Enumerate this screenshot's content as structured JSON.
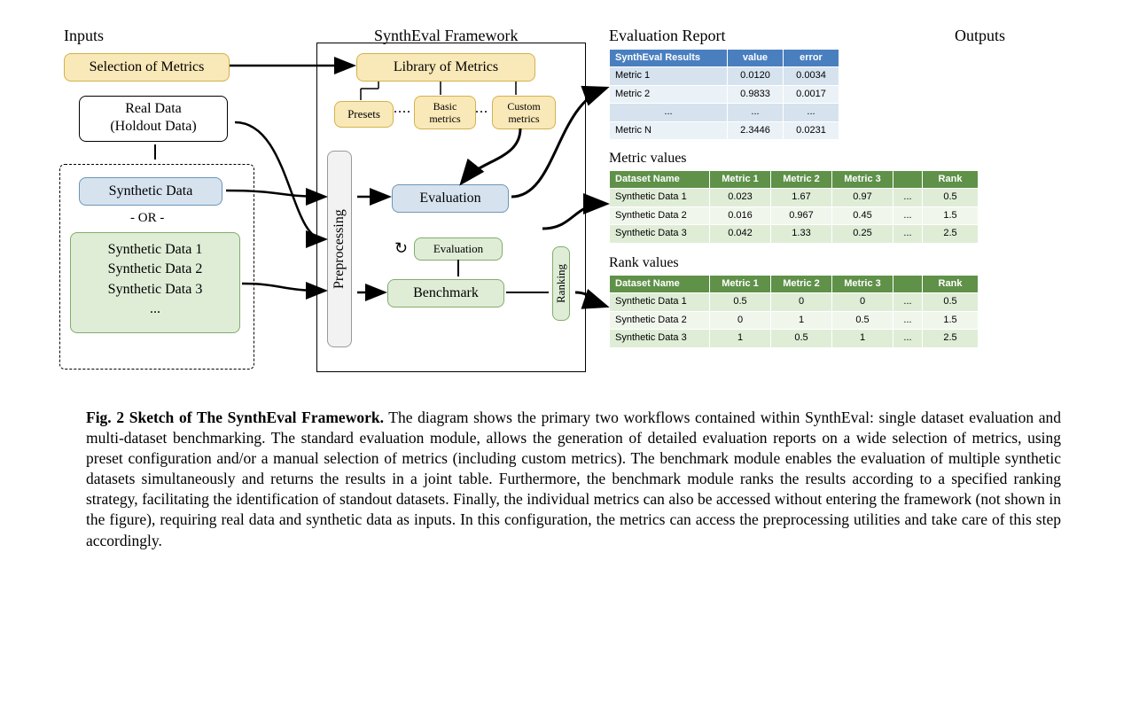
{
  "headings": {
    "inputs": "Inputs",
    "framework": "SynthEval Framework",
    "report": "Evaluation Report",
    "outputs": "Outputs",
    "metric_values": "Metric values",
    "rank_values": "Rank values"
  },
  "inputs": {
    "selection": "Selection of Metrics",
    "real": "Real Data\n(Holdout Data)",
    "synth_single": "Synthetic Data",
    "or": "- OR -",
    "synth_multi": "Synthetic Data 1\nSynthetic Data 2\nSynthetic Data 3\n...",
    "synth1": "Synthetic Data 1",
    "synth2": "Synthetic Data 2",
    "synth3": "Synthetic Data 3",
    "dots": "..."
  },
  "framework": {
    "library": "Library of Metrics",
    "presets": "Presets",
    "basic": "Basic\nmetrics",
    "custom": "Custom\nmetrics",
    "preprocessing": "Preprocessing",
    "evaluation": "Evaluation",
    "evaluation_small": "Evaluation",
    "benchmark": "Benchmark",
    "ranking": "Ranking",
    "refresh": "↻"
  },
  "report_table": {
    "headers": [
      "SynthEval Results",
      "value",
      "error"
    ],
    "rows": [
      [
        "Metric 1",
        "0.0120",
        "0.0034"
      ],
      [
        "Metric 2",
        "0.9833",
        "0.0017"
      ],
      [
        "...",
        "...",
        "..."
      ],
      [
        "Metric N",
        "2.3446",
        "0.0231"
      ]
    ]
  },
  "metric_table": {
    "headers": [
      "Dataset Name",
      "Metric 1",
      "Metric 2",
      "Metric 3",
      "",
      "Rank"
    ],
    "rows": [
      [
        "Synthetic Data 1",
        "0.023",
        "1.67",
        "0.97",
        "...",
        "0.5"
      ],
      [
        "Synthetic Data 2",
        "0.016",
        "0.967",
        "0.45",
        "...",
        "1.5"
      ],
      [
        "Synthetic Data 3",
        "0.042",
        "1.33",
        "0.25",
        "...",
        "2.5"
      ]
    ]
  },
  "rank_table": {
    "headers": [
      "Dataset Name",
      "Metric 1",
      "Metric 2",
      "Metric 3",
      "",
      "Rank"
    ],
    "rows": [
      [
        "Synthetic Data 1",
        "0.5",
        "0",
        "0",
        "...",
        "0.5"
      ],
      [
        "Synthetic Data 2",
        "0",
        "1",
        "0.5",
        "...",
        "1.5"
      ],
      [
        "Synthetic Data 3",
        "1",
        "0.5",
        "1",
        "...",
        "2.5"
      ]
    ]
  },
  "caption": {
    "prefix": "Fig. 2  Sketch of The SynthEval Framework.",
    "body": " The diagram shows the primary two workflows contained within SynthEval: single dataset evaluation and multi-dataset benchmarking. The standard evaluation module, allows the generation of detailed evaluation reports on a wide selection of metrics, using preset configuration and/or a manual selection of metrics (including custom metrics). The benchmark module enables the evaluation of multiple synthetic datasets simultaneously and returns the results in a joint table. Furthermore, the benchmark module ranks the results according to a specified ranking strategy, facilitating the identification of standout datasets. Finally, the individual metrics can also be accessed without entering the framework (not shown in the figure), requiring real data and synthetic data as inputs. In this configuration, the metrics can access the preprocessing utilities and take care of this step accordingly."
  }
}
